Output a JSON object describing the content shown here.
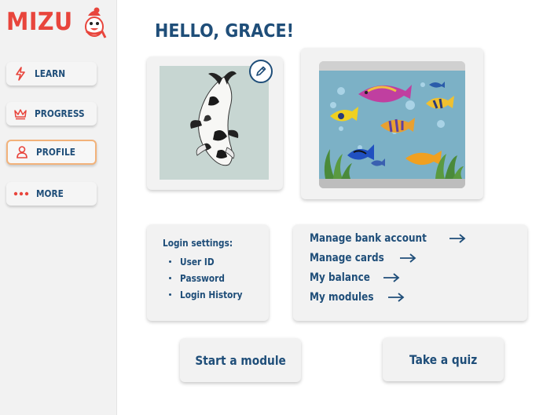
{
  "brand": {
    "name": "MIZU",
    "color": "#e8453c"
  },
  "nav": {
    "items": [
      {
        "label": "LEARN",
        "icon": "lightning-icon",
        "active": false
      },
      {
        "label": "PROGRESS",
        "icon": "crown-icon",
        "active": false
      },
      {
        "label": "PROFILE",
        "icon": "person-icon",
        "active": true
      },
      {
        "label": "MORE",
        "icon": "more-dots-icon",
        "active": false
      }
    ]
  },
  "greeting": "HELLO, GRACE!",
  "profile": {
    "avatar": "koi-fish-image",
    "edit_icon": "pencil-icon"
  },
  "aquarium": {
    "image": "aquarium-image"
  },
  "login_settings": {
    "title": "Login settings:",
    "items": [
      "User ID",
      "Password",
      "Login History"
    ]
  },
  "links": [
    {
      "label": "Manage bank account"
    },
    {
      "label": "Manage cards"
    },
    {
      "label": "My balance"
    },
    {
      "label": "My modules"
    }
  ],
  "actions": {
    "start": "Start a module",
    "quiz": "Take a quiz"
  },
  "colors": {
    "primary": "#1f4e79",
    "accent": "#e8453c",
    "active_border": "#f2b27a",
    "panel": "#f2f2f2"
  }
}
